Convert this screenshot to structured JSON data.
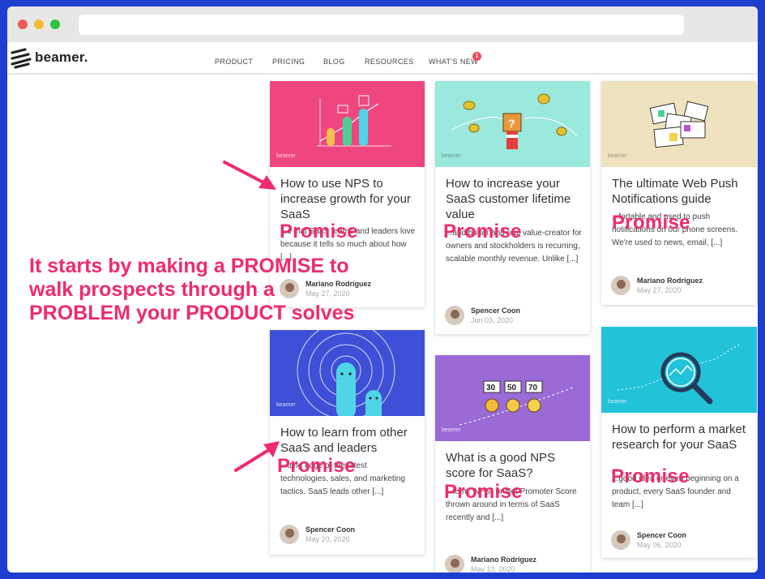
{
  "brand": {
    "name": "beamer."
  },
  "nav": {
    "items": [
      "PRODUCT",
      "PRICING",
      "BLOG",
      "RESOURCES",
      "WHAT'S NEW"
    ],
    "badge": "1"
  },
  "thumbs": {
    "mini_logo": "beamer"
  },
  "cards": [
    {
      "title": "How to use NPS to increase growth for your SaaS",
      "excerpt": "...c that SaaS teams and leaders love because it tells so much about how [...]",
      "author": "Mariano Rodríguez",
      "date": "May 27, 2020",
      "overlay": "Promise"
    },
    {
      "title": "How to increase your SaaS customer lifetime value",
      "excerpt": "...and butter and real value-creator for owners and stockholders is recurring, scalable monthly revenue. Unlike [...]",
      "author": "Spencer Coon",
      "date": "Jun 03, 2020",
      "overlay": "Promise"
    },
    {
      "title": "The ultimate Web Push Notifications guide",
      "excerpt": "...fortable and used to push notifications on our phone screens. We're used to news, email, [...]",
      "author": "Mariano Rodríguez",
      "date": "May 27, 2020",
      "overlay": "Promise"
    },
    {
      "title": "How to learn from other SaaS and leaders",
      "excerpt": "...tting edge of the latest technologies, sales, and marketing tactics. SaaS leads other [...]",
      "author": "Spencer Coon",
      "date": "May 20, 2020",
      "overlay": "Promise"
    },
    {
      "title": "What is a good NPS score for SaaS?",
      "excerpt": "...term \"NPS\" or Net Promoter Score thrown around in terms of SaaS recently and [...]",
      "author": "Mariano Rodríguez",
      "date": "May 13, 2020",
      "overlay": "Promise",
      "scores": [
        "30",
        "50",
        "70"
      ]
    },
    {
      "title": "How to perform a market research for your SaaS",
      "excerpt": "...good idea or even beginning on a product, every SaaS founder and team [...]",
      "author": "Spencer Coon",
      "date": "May 06, 2020",
      "overlay": "Promise"
    }
  ],
  "annotation": {
    "callout": "It starts by making a PROMISE to walk prospects through a PROBLEM your PRODUCT solves"
  },
  "colors": {
    "frame": "#1d3fd0",
    "accent": "#ef2b6c",
    "pink": "#f0467f",
    "mint": "#9be8dc",
    "sand": "#efe3bf",
    "indigo": "#3e4fd8",
    "purple": "#9a6ad6",
    "cyan": "#22c3d8"
  }
}
